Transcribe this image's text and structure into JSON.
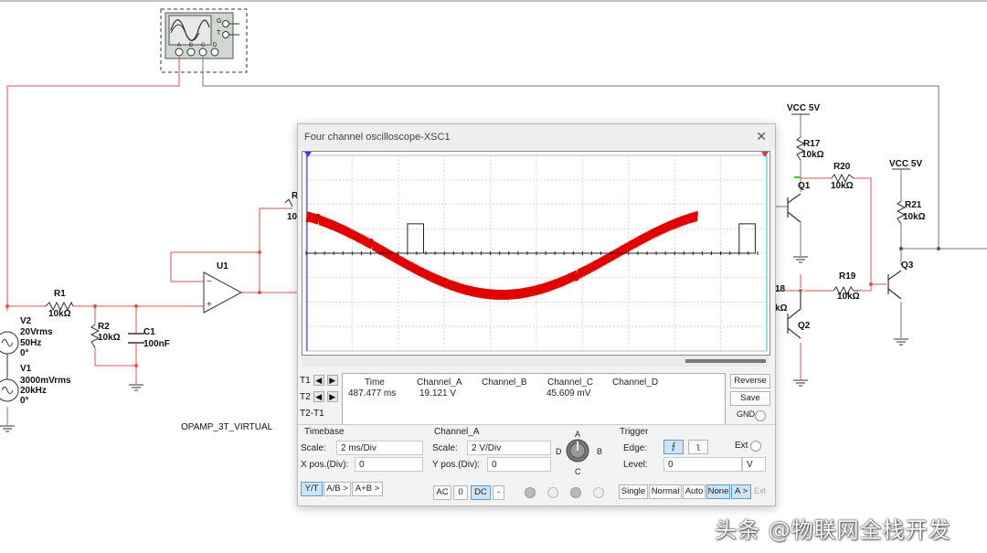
{
  "window_title": "Four channel oscilloscope-XSC1",
  "close_glyph": "✕",
  "schematic": {
    "vcc1": "VCC 5V",
    "vcc2": "VCC 5V",
    "r17": "R17",
    "r17_val": "10kΩ",
    "r20": "R20",
    "r20_val": "10kΩ",
    "r21": "R21",
    "r21_val": "10kΩ",
    "q1": "Q1",
    "q2": "Q2",
    "q3": "Q3",
    "r19": "R19",
    "r19_val": "10kΩ",
    "r18_part": "18",
    "r18_val_part": "kΩ",
    "r_partial": "R",
    "r_partial_val": "10",
    "u1": "U1",
    "r1": "R1",
    "r1_val": "10kΩ",
    "r2": "R2",
    "r2_val": "10kΩ",
    "c1": "C1",
    "c1_val": "100nF",
    "v2": "V2",
    "v2_a": "20Vrms",
    "v2_b": "50Hz",
    "v2_c": "0°",
    "v1": "V1",
    "v1_a": "3000mVrms",
    "v1_b": "20kHz",
    "v1_c": "0°",
    "opamp_model": "OPAMP_3T_VIRTUAL",
    "scope_g": "G",
    "scope_t": "T",
    "scope_a": "A",
    "scope_b": "B",
    "scope_c": "C",
    "scope_d": "D"
  },
  "readout": {
    "t1": "T1",
    "t2": "T2",
    "t2t1": "T2-T1",
    "left_arrow": "◀",
    "right_arrow": "▶",
    "headers": [
      "Time",
      "Channel_A",
      "Channel_B",
      "Channel_C",
      "Channel_D"
    ],
    "values": [
      "487.477 ms",
      "19.121 V",
      "",
      "45.609 mV",
      ""
    ],
    "reverse": "Reverse",
    "save": "Save",
    "gnd": "GND"
  },
  "timebase": {
    "title": "Timebase",
    "scale_label": "Scale:",
    "scale_value": "2 ms/Div",
    "xpos_label": "X pos.(Div):",
    "xpos_value": "0",
    "yt": "Y/T",
    "ab": "A/B >",
    "apb": "A+B >"
  },
  "channel": {
    "title": "Channel_A",
    "scale_label": "Scale:",
    "scale_value": "2  V/Div",
    "ypos_label": "Y pos.(Div):",
    "ypos_value": "0",
    "ac": "AC",
    "zero": "0",
    "dc": "DC",
    "minus": "-",
    "knob_a": "A",
    "knob_b": "B",
    "knob_c": "C",
    "knob_d": "D"
  },
  "trigger": {
    "title": "Trigger",
    "edge_label": "Edge:",
    "rise_glyph": "⨍",
    "fall_glyph": "ʅ",
    "ext_label": "Ext",
    "level_label": "Level:",
    "level_value": "0",
    "level_unit": "V",
    "single": "Single",
    "normal": "Normal",
    "auto": "Auto",
    "none": "None",
    "a_sel": "A >",
    "ext": "Ext"
  },
  "watermark": "头条 @物联网全栈开发",
  "colors": {
    "wire": "#d9534f",
    "trace_a": "#e00000",
    "trace_c": "#222222",
    "accent": "#5c9ad4"
  },
  "chart_data": {
    "type": "line",
    "title": "",
    "xlabel": "",
    "ylabel": "",
    "x_divisions": 10,
    "y_divisions": 8,
    "time_per_div_ms": 2,
    "volts_per_div_A": 2,
    "series": [
      {
        "name": "Channel_A",
        "shape": "50Hz sine with 20kHz ripple",
        "peak_div": 1.7,
        "ripple_div": 0.4,
        "phase_start_div": 0.0
      },
      {
        "name": "Channel_C",
        "shape": "pulse train",
        "high_div": 1.2,
        "pulses_at_div": [
          2.2,
          9.4
        ],
        "pulse_width_div": 0.35
      }
    ]
  }
}
